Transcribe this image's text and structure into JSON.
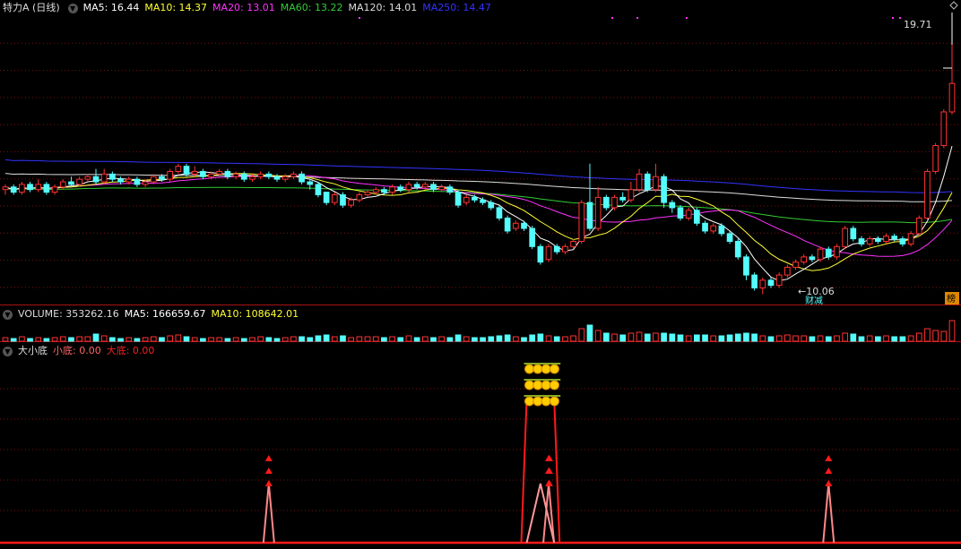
{
  "header": {
    "title": "特力A (日线)",
    "ma": [
      {
        "label": "MA5: 16.44",
        "color": "#ffffff"
      },
      {
        "label": "MA10: 14.37",
        "color": "#ffff33"
      },
      {
        "label": "MA20: 13.01",
        "color": "#ff33ff"
      },
      {
        "label": "MA60: 13.22",
        "color": "#33cc33"
      },
      {
        "label": "MA120: 14.01",
        "color": "#dddddd"
      },
      {
        "label": "MA250: 14.47",
        "color": "#3333ff"
      }
    ]
  },
  "volume_header": [
    {
      "label": "VOLUME: 353262.16",
      "color": "#dddddd"
    },
    {
      "label": "MA5: 166659.67",
      "color": "#ffffff"
    },
    {
      "label": "MA10: 108642.01",
      "color": "#ffff33"
    }
  ],
  "indicator_header": [
    {
      "label": "大小底",
      "color": "#dddddd"
    },
    {
      "label": "小底: 0.00",
      "color": "#ff6666"
    },
    {
      "label": "大底: 0.00",
      "color": "#ee2222"
    }
  ],
  "price_labels": {
    "high": "19.71",
    "low": "10.06",
    "signal": "财减",
    "side_tag": "榜"
  },
  "colors": {
    "up": "#ff3232",
    "down": "#54fcfc",
    "grid": "#7a1010",
    "indicator": "#ff1a1a"
  },
  "chart_data": {
    "type": "candlestick",
    "price_range": [
      9.8,
      20.8
    ],
    "high": 19.71,
    "low": 10.06,
    "candles": [
      [
        14.1,
        14.2,
        14.3,
        13.9
      ],
      [
        14.2,
        14.0,
        14.3,
        13.9
      ],
      [
        14.0,
        14.3,
        14.4,
        13.9
      ],
      [
        14.3,
        14.1,
        14.4,
        14.0
      ],
      [
        14.1,
        14.3,
        14.5,
        14.0
      ],
      [
        14.3,
        14.0,
        14.4,
        13.9
      ],
      [
        14.0,
        14.2,
        14.3,
        13.9
      ],
      [
        14.2,
        14.4,
        14.5,
        14.1
      ],
      [
        14.4,
        14.3,
        14.6,
        14.2
      ],
      [
        14.3,
        14.5,
        14.6,
        14.2
      ],
      [
        14.5,
        14.6,
        14.7,
        14.4
      ],
      [
        14.6,
        14.4,
        14.9,
        14.3
      ],
      [
        14.4,
        14.7,
        14.9,
        14.3
      ],
      [
        14.7,
        14.5,
        14.8,
        14.4
      ],
      [
        14.5,
        14.4,
        14.6,
        14.3
      ],
      [
        14.4,
        14.5,
        14.6,
        14.3
      ],
      [
        14.5,
        14.3,
        14.6,
        14.2
      ],
      [
        14.3,
        14.4,
        14.5,
        14.2
      ],
      [
        14.4,
        14.6,
        14.7,
        14.3
      ],
      [
        14.6,
        14.5,
        14.7,
        14.4
      ],
      [
        14.5,
        14.8,
        14.9,
        14.4
      ],
      [
        14.8,
        15.0,
        15.1,
        14.7
      ],
      [
        15.0,
        14.7,
        15.1,
        14.6
      ],
      [
        14.7,
        14.8,
        15.0,
        14.6
      ],
      [
        14.8,
        14.6,
        14.9,
        14.5
      ],
      [
        14.6,
        14.7,
        14.8,
        14.5
      ],
      [
        14.7,
        14.8,
        14.9,
        14.6
      ],
      [
        14.8,
        14.6,
        14.9,
        14.5
      ],
      [
        14.6,
        14.7,
        14.8,
        14.5
      ],
      [
        14.7,
        14.5,
        14.8,
        14.4
      ],
      [
        14.5,
        14.6,
        14.7,
        14.4
      ],
      [
        14.6,
        14.7,
        14.8,
        14.5
      ],
      [
        14.7,
        14.6,
        14.8,
        14.5
      ],
      [
        14.6,
        14.5,
        14.7,
        14.4
      ],
      [
        14.5,
        14.6,
        14.7,
        14.4
      ],
      [
        14.6,
        14.7,
        14.8,
        14.5
      ],
      [
        14.7,
        14.4,
        14.8,
        14.3
      ],
      [
        14.4,
        14.3,
        14.5,
        14.1
      ],
      [
        14.3,
        13.9,
        14.4,
        13.8
      ],
      [
        14.0,
        13.6,
        14.0,
        13.5
      ],
      [
        13.6,
        13.9,
        14.0,
        13.5
      ],
      [
        13.9,
        13.5,
        14.0,
        13.4
      ],
      [
        13.5,
        13.7,
        13.8,
        13.4
      ],
      [
        13.7,
        13.9,
        14.0,
        13.6
      ],
      [
        13.9,
        14.0,
        14.1,
        13.8
      ],
      [
        14.0,
        14.1,
        14.2,
        13.9
      ],
      [
        14.1,
        14.0,
        14.2,
        13.9
      ],
      [
        14.0,
        14.2,
        14.3,
        13.9
      ],
      [
        14.2,
        14.1,
        14.3,
        14.0
      ],
      [
        14.1,
        14.3,
        14.4,
        14.0
      ],
      [
        14.3,
        14.2,
        14.4,
        14.1
      ],
      [
        14.2,
        14.3,
        14.4,
        14.1
      ],
      [
        14.3,
        14.1,
        14.4,
        14.0
      ],
      [
        14.1,
        14.2,
        14.3,
        14.0
      ],
      [
        14.2,
        14.0,
        14.3,
        13.9
      ],
      [
        14.0,
        13.5,
        14.1,
        13.4
      ],
      [
        13.6,
        13.8,
        13.9,
        13.5
      ],
      [
        13.8,
        13.7,
        13.9,
        13.6
      ],
      [
        13.7,
        13.6,
        13.8,
        13.5
      ],
      [
        13.6,
        13.4,
        13.7,
        13.3
      ],
      [
        13.4,
        13.0,
        13.5,
        12.9
      ],
      [
        13.0,
        12.5,
        13.1,
        12.4
      ],
      [
        12.6,
        12.8,
        12.9,
        12.5
      ],
      [
        12.8,
        12.6,
        12.9,
        12.5
      ],
      [
        12.6,
        11.9,
        12.7,
        11.8
      ],
      [
        11.9,
        11.3,
        12.0,
        11.2
      ],
      [
        11.4,
        11.9,
        12.0,
        11.3
      ],
      [
        11.9,
        11.7,
        12.0,
        11.6
      ],
      [
        11.7,
        11.9,
        12.0,
        11.6
      ],
      [
        11.9,
        12.1,
        12.2,
        11.8
      ],
      [
        12.1,
        13.6,
        13.7,
        12.0
      ],
      [
        13.6,
        12.6,
        15.1,
        12.5
      ],
      [
        12.6,
        13.8,
        14.2,
        12.5
      ],
      [
        13.8,
        13.4,
        13.9,
        13.3
      ],
      [
        13.4,
        13.8,
        13.9,
        13.3
      ],
      [
        13.8,
        13.7,
        14.0,
        13.6
      ],
      [
        13.7,
        14.1,
        14.4,
        13.6
      ],
      [
        14.1,
        14.7,
        14.9,
        14.0
      ],
      [
        14.7,
        14.1,
        14.8,
        14.0
      ],
      [
        14.1,
        14.6,
        15.1,
        14.0
      ],
      [
        14.6,
        13.6,
        14.7,
        13.4
      ],
      [
        13.6,
        13.4,
        13.7,
        13.2
      ],
      [
        13.4,
        13.0,
        13.5,
        12.9
      ],
      [
        13.0,
        13.3,
        13.4,
        12.9
      ],
      [
        13.3,
        12.8,
        13.4,
        12.7
      ],
      [
        12.8,
        12.5,
        12.9,
        12.4
      ],
      [
        12.5,
        12.7,
        12.8,
        12.4
      ],
      [
        12.7,
        12.4,
        12.8,
        12.3
      ],
      [
        12.4,
        12.1,
        12.5,
        12.0
      ],
      [
        12.1,
        11.5,
        12.2,
        11.4
      ],
      [
        11.5,
        10.8,
        11.6,
        10.6
      ],
      [
        10.8,
        10.3,
        10.9,
        10.2
      ],
      [
        10.3,
        10.6,
        10.7,
        10.06
      ],
      [
        10.6,
        10.4,
        10.7,
        10.3
      ],
      [
        10.4,
        10.8,
        10.9,
        10.3
      ],
      [
        10.8,
        11.1,
        11.2,
        10.7
      ],
      [
        11.1,
        11.3,
        11.4,
        11.0
      ],
      [
        11.3,
        11.5,
        11.6,
        11.2
      ],
      [
        11.5,
        11.4,
        11.6,
        11.3
      ],
      [
        11.4,
        11.8,
        11.9,
        11.3
      ],
      [
        11.8,
        11.5,
        11.9,
        11.4
      ],
      [
        11.5,
        11.9,
        12.0,
        11.4
      ],
      [
        11.9,
        12.6,
        12.7,
        11.8
      ],
      [
        12.6,
        12.2,
        12.7,
        12.1
      ],
      [
        12.2,
        12.0,
        12.3,
        11.9
      ],
      [
        12.0,
        12.2,
        12.3,
        11.9
      ],
      [
        12.2,
        12.1,
        12.3,
        12.0
      ],
      [
        12.1,
        12.3,
        12.4,
        12.0
      ],
      [
        12.3,
        12.2,
        12.4,
        12.1
      ],
      [
        12.2,
        12.0,
        12.3,
        11.9
      ],
      [
        12.0,
        12.4,
        12.5,
        11.9
      ],
      [
        12.4,
        13.0,
        13.1,
        12.3
      ],
      [
        13.0,
        14.8,
        14.9,
        12.9
      ],
      [
        14.8,
        15.8,
        15.9,
        14.7
      ],
      [
        15.8,
        17.1,
        17.2,
        15.7
      ],
      [
        17.1,
        18.2,
        19.71,
        17.0
      ]
    ],
    "volume": [
      4,
      3,
      5,
      3,
      4,
      3,
      4,
      5,
      4,
      5,
      5,
      8,
      6,
      4,
      3,
      4,
      3,
      4,
      5,
      4,
      6,
      7,
      5,
      4,
      3,
      4,
      4,
      3,
      4,
      3,
      4,
      5,
      4,
      3,
      4,
      5,
      5,
      4,
      6,
      7,
      5,
      6,
      4,
      5,
      5,
      5,
      4,
      5,
      4,
      6,
      4,
      5,
      4,
      5,
      4,
      7,
      5,
      4,
      4,
      5,
      6,
      7,
      5,
      4,
      7,
      8,
      6,
      5,
      5,
      6,
      14,
      18,
      12,
      9,
      8,
      7,
      9,
      10,
      8,
      9,
      9,
      8,
      7,
      6,
      7,
      7,
      6,
      6,
      7,
      8,
      9,
      8,
      6,
      5,
      6,
      7,
      6,
      6,
      5,
      6,
      5,
      6,
      9,
      8,
      5,
      6,
      5,
      6,
      5,
      5,
      6,
      9,
      14,
      12,
      11,
      23
    ],
    "indicator": {
      "xiaodi_peak_indices": [
        32,
        66,
        100
      ],
      "dadi_range": [
        63,
        67
      ]
    }
  }
}
